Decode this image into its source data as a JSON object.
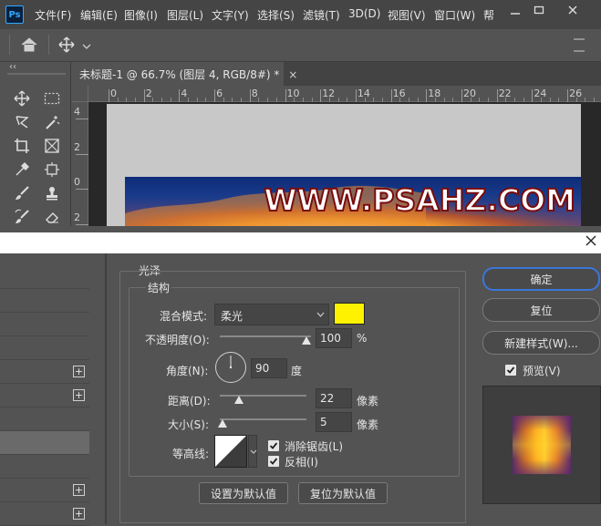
{
  "app": {
    "logo": "Ps"
  },
  "menubar": {
    "items": [
      "文件(F)",
      "编辑(E)",
      "图像(I)",
      "图层(L)",
      "文字(Y)",
      "选择(S)",
      "滤镜(T)",
      "3D(D)",
      "视图(V)",
      "窗口(W)",
      "帮"
    ]
  },
  "toolstrip": {
    "collapse": "‹‹"
  },
  "document": {
    "tab_title": "未标题-1 @ 66.7% (图层 4, RGB/8#) *",
    "tab_close": "×",
    "ruler_h": [
      "0",
      "2",
      "4",
      "6",
      "8",
      "10",
      "12",
      "14",
      "16",
      "18",
      "20",
      "22",
      "24",
      "26"
    ],
    "ruler_v": [
      "4",
      "2",
      "0",
      "2"
    ],
    "watermark": "WWW.PSAHZ.COM"
  },
  "dialog": {
    "close": "×",
    "section_title": "光泽",
    "structure_title": "结构",
    "blend_mode": {
      "label": "混合模式:",
      "value": "柔光"
    },
    "swatch_color": "#fff200",
    "opacity": {
      "label": "不透明度(O):",
      "value": "100",
      "unit": "%",
      "level": 1.0
    },
    "angle": {
      "label": "角度(N):",
      "value": "90",
      "unit": "度"
    },
    "distance": {
      "label": "距离(D):",
      "value": "22",
      "unit": "像素",
      "level": 0.22
    },
    "size": {
      "label": "大小(S):",
      "value": "5",
      "unit": "像素",
      "level": 0.03
    },
    "contour": {
      "label": "等高线:"
    },
    "anti_alias": {
      "label": "消除锯齿(L)",
      "checked": true
    },
    "invert": {
      "label": "反相(I)",
      "checked": true
    },
    "set_default": "设置为默认值",
    "reset_default": "复位为默认值",
    "ok": "确定",
    "reset": "复位",
    "new_style": "新建样式(W)...",
    "preview": {
      "label": "预览(V)",
      "checked": true
    },
    "style_plus": [
      "+",
      "+",
      "+",
      "+"
    ]
  }
}
